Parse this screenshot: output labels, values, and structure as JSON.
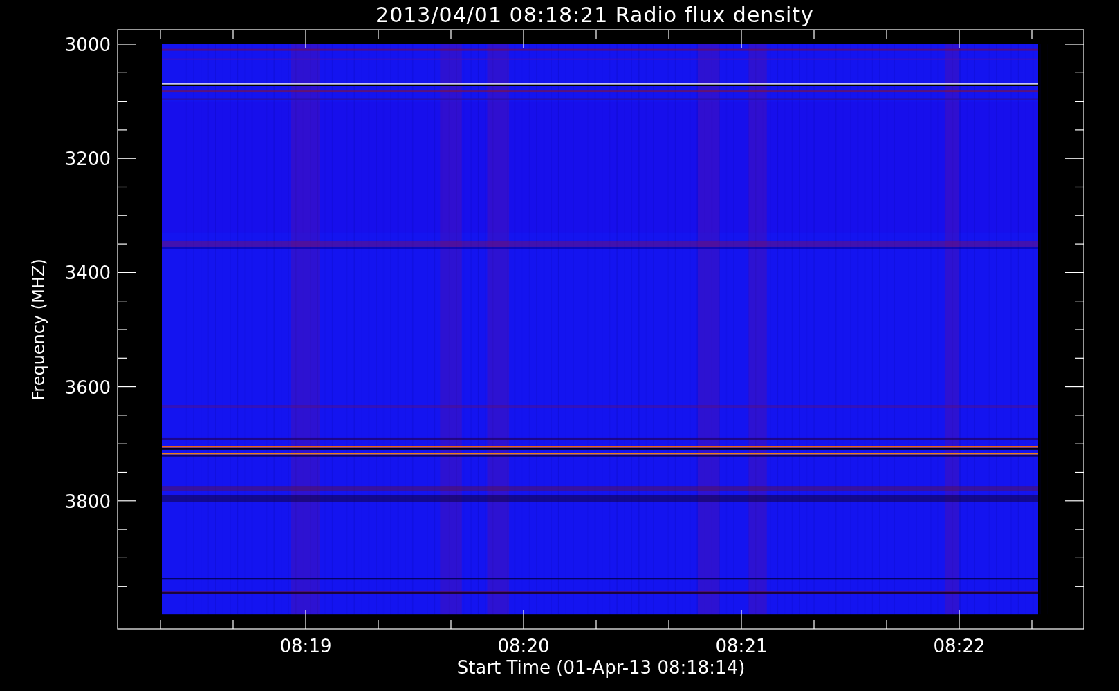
{
  "plot": {
    "title": "2013/04/01 08:18:21 Radio flux density",
    "y_axis": {
      "label": "Frequency (MHZ)",
      "tick_labels": [
        "3000",
        "3200",
        "3400",
        "3600",
        "3800"
      ]
    },
    "x_axis": {
      "label": "Start Time (01-Apr-13 08:18:14)",
      "tick_labels": [
        "08:19",
        "08:20",
        "08:21",
        "08:22"
      ]
    }
  }
}
